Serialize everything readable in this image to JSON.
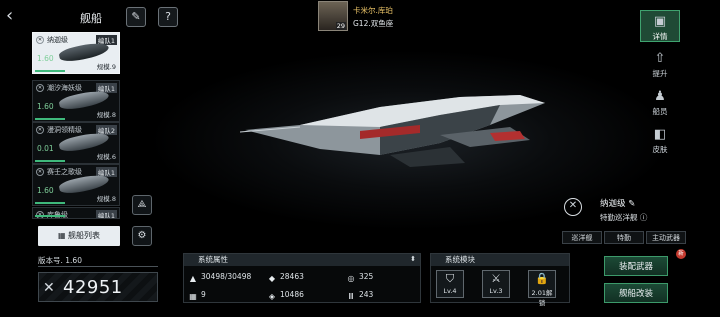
{
  "header": {
    "back_icon": "chevron-left-icon",
    "title": "舰船",
    "tool_icon": "wrench-icon",
    "help_label": "?"
  },
  "commander": {
    "name": "卡米尔.库珀",
    "rank": "29",
    "constellation": "G12.双鱼座"
  },
  "ship_list": [
    {
      "name": "纳迦级",
      "fleet": "编队1",
      "speed": "1.60",
      "scale": "规模.9",
      "selected": true
    },
    {
      "name": "潮汐海妖级",
      "fleet": "编队1",
      "speed": "1.60",
      "scale": "规模.8",
      "selected": false
    },
    {
      "name": "漫洞领精级",
      "fleet": "编队2",
      "speed": "0.01",
      "scale": "规模.6",
      "selected": false
    },
    {
      "name": "赛壬之歌级",
      "fleet": "编队1",
      "speed": "1.60",
      "scale": "规模.8",
      "selected": false
    },
    {
      "name": "库鲁级",
      "fleet": "编队1",
      "speed": "",
      "scale": "",
      "selected": false
    }
  ],
  "list_button": "舰船列表",
  "version": "版本号. 1.60",
  "power": "42951",
  "right_tabs": [
    {
      "label": "详情",
      "icon": "detail-icon",
      "selected": true
    },
    {
      "label": "提升",
      "icon": "upgrade-icon",
      "selected": false
    },
    {
      "label": "船员",
      "icon": "crew-icon",
      "selected": false
    },
    {
      "label": "皮肤",
      "icon": "skin-icon",
      "selected": false
    }
  ],
  "ship_info": {
    "class_name": "纳迦级",
    "subtitle": "特勤巡洋舰",
    "tags": [
      "巡洋舰",
      "特勤",
      "主动武器"
    ]
  },
  "system_attrs": {
    "title": "系统属性",
    "items": [
      {
        "icon": "hull-icon",
        "value": "30498/30498"
      },
      {
        "icon": "armor-icon",
        "value": "28463"
      },
      {
        "icon": "speed-icon",
        "value": "325"
      },
      {
        "icon": "grid-icon",
        "value": "9"
      },
      {
        "icon": "energy-icon",
        "value": "10486"
      },
      {
        "icon": "cargo-icon",
        "value": "243"
      }
    ]
  },
  "system_modules": {
    "title": "系统模块",
    "items": [
      {
        "icon": "shield-module-icon",
        "label": "Lv.4"
      },
      {
        "icon": "weapon-module-icon",
        "label": "Lv.3"
      },
      {
        "icon": "lock-icon",
        "label": "2.01解锁"
      }
    ]
  },
  "buttons": {
    "equip": "装配武器",
    "modify": "舰船改装",
    "equip_badge": "新"
  },
  "colors": {
    "accent_green": "#3fa36f",
    "commander_name": "#f0c86a",
    "alert_red": "#c43a2f"
  }
}
